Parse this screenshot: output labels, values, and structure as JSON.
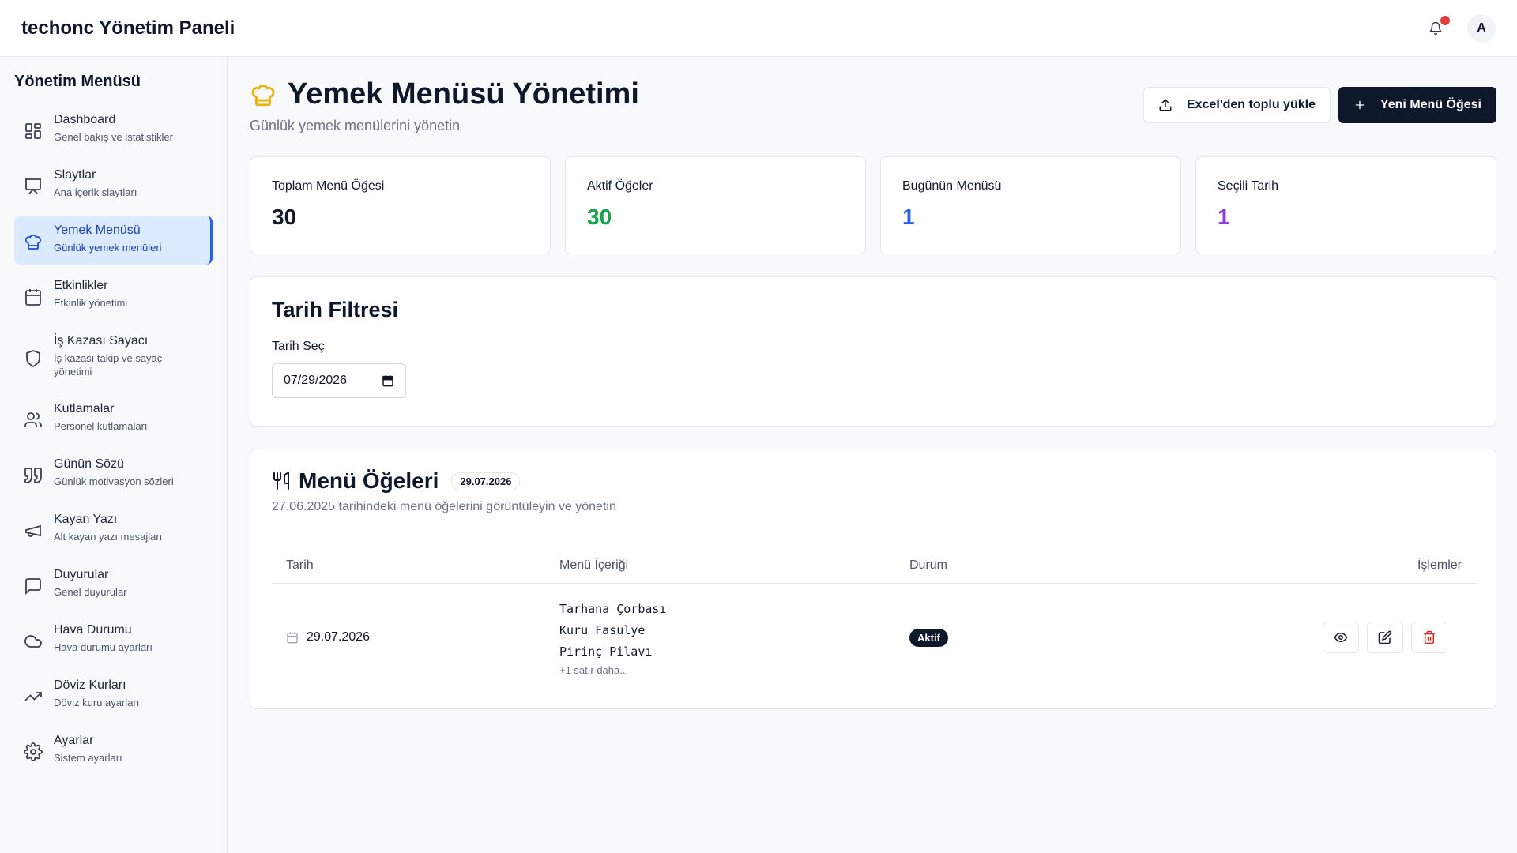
{
  "app": {
    "title": "techonc Yönetim Paneli",
    "avatar_initial": "A"
  },
  "sidebar": {
    "title": "Yönetim Menüsü",
    "items": [
      {
        "label": "Dashboard",
        "sub": "Genel bakış ve istatistikler",
        "icon": "dashboard-icon"
      },
      {
        "label": "Slaytlar",
        "sub": "Ana içerik slaytları",
        "icon": "presentation-icon"
      },
      {
        "label": "Yemek Menüsü",
        "sub": "Günlük yemek menüleri",
        "icon": "chef-hat-icon",
        "active": true
      },
      {
        "label": "Etkinlikler",
        "sub": "Etkinlik yönetimi",
        "icon": "calendar-icon"
      },
      {
        "label": "İş Kazası Sayacı",
        "sub": "İş kazası takip ve sayaç yönetimi",
        "icon": "shield-icon"
      },
      {
        "label": "Kutlamalar",
        "sub": "Personel kutlamaları",
        "icon": "users-icon"
      },
      {
        "label": "Günün Sözü",
        "sub": "Günlük motivasyon sözleri",
        "icon": "quote-icon"
      },
      {
        "label": "Kayan Yazı",
        "sub": "Alt kayan yazı mesajları",
        "icon": "megaphone-icon"
      },
      {
        "label": "Duyurular",
        "sub": "Genel duyurular",
        "icon": "message-icon"
      },
      {
        "label": "Hava Durumu",
        "sub": "Hava durumu ayarları",
        "icon": "cloud-icon"
      },
      {
        "label": "Döviz Kurları",
        "sub": "Döviz kuru ayarları",
        "icon": "trending-up-icon"
      },
      {
        "label": "Ayarlar",
        "sub": "Sistem ayarları",
        "icon": "gear-icon"
      }
    ]
  },
  "page": {
    "title": "Yemek Menüsü Yönetimi",
    "subtitle": "Günlük yemek menülerini yönetin",
    "excel_button": "Excel'den toplu yükle",
    "new_button": "Yeni Menü Öğesi"
  },
  "stats": [
    {
      "label": "Toplam Menü Öğesi",
      "value": "30",
      "color": "#111827"
    },
    {
      "label": "Aktif Öğeler",
      "value": "30",
      "color": "#16a34a"
    },
    {
      "label": "Bugünün Menüsü",
      "value": "1",
      "color": "#2563eb"
    },
    {
      "label": "Seçili Tarih",
      "value": "1",
      "color": "#9333ea"
    }
  ],
  "filter": {
    "title": "Tarih Filtresi",
    "label": "Tarih Seç",
    "value": "07/29/2026"
  },
  "menu": {
    "title": "Menü Öğeleri",
    "badge": "29.07.2026",
    "subtitle": "27.06.2025 tarihindeki menü öğelerini görüntüleyin ve yönetin",
    "columns": {
      "date": "Tarih",
      "content": "Menü İçeriği",
      "status": "Durum",
      "actions": "İşlemler"
    },
    "rows": [
      {
        "date": "29.07.2026",
        "lines": [
          "Tarhana Çorbası",
          "Kuru Fasulye",
          "Pirinç Pilavı"
        ],
        "more": "+1 satır daha...",
        "status": "Aktif"
      }
    ]
  }
}
